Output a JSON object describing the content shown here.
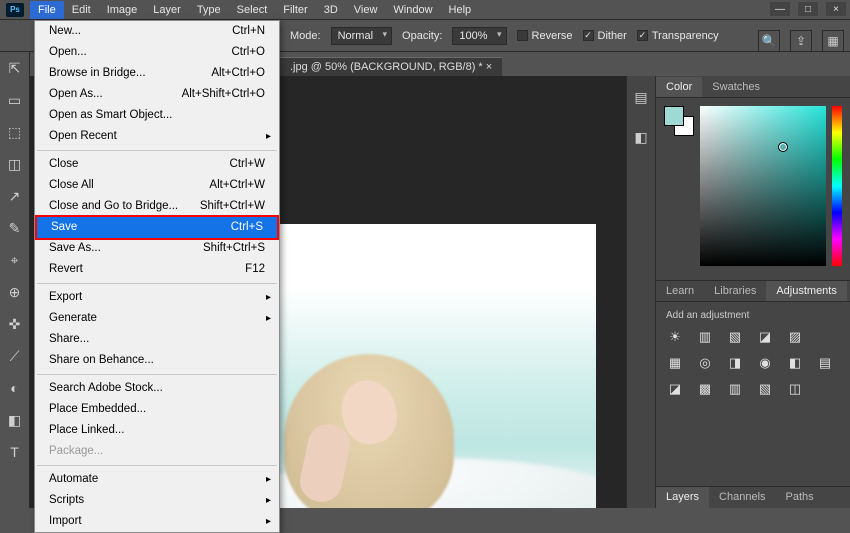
{
  "menubar": {
    "logo": "Ps",
    "items": [
      "File",
      "Edit",
      "Image",
      "Layer",
      "Type",
      "Select",
      "Filter",
      "3D",
      "View",
      "Window",
      "Help"
    ],
    "active_index": 0
  },
  "window_controls": {
    "min": "—",
    "max": "□",
    "close": "×"
  },
  "options_bar": {
    "mode_label": "Mode:",
    "mode_value": "Normal",
    "opacity_label": "Opacity:",
    "opacity_value": "100%",
    "reverse_label": "Reverse",
    "reverse_checked": false,
    "dither_label": "Dither",
    "dither_checked": true,
    "transparency_label": "Transparency",
    "transparency_checked": true
  },
  "document_tab": ".jpg @ 50% (BACKGROUND, RGB/8) *",
  "file_menu": [
    {
      "label": "New...",
      "accel": "Ctrl+N"
    },
    {
      "label": "Open...",
      "accel": "Ctrl+O"
    },
    {
      "label": "Browse in Bridge...",
      "accel": "Alt+Ctrl+O"
    },
    {
      "label": "Open As...",
      "accel": "Alt+Shift+Ctrl+O"
    },
    {
      "label": "Open as Smart Object...",
      "accel": ""
    },
    {
      "label": "Open Recent",
      "accel": "",
      "submenu": true
    },
    {
      "sep": true
    },
    {
      "label": "Close",
      "accel": "Ctrl+W"
    },
    {
      "label": "Close All",
      "accel": "Alt+Ctrl+W"
    },
    {
      "label": "Close and Go to Bridge...",
      "accel": "Shift+Ctrl+W"
    },
    {
      "label": "Save",
      "accel": "Ctrl+S",
      "highlighted": true
    },
    {
      "label": "Save As...",
      "accel": "Shift+Ctrl+S"
    },
    {
      "label": "Revert",
      "accel": "F12"
    },
    {
      "sep": true
    },
    {
      "label": "Export",
      "accel": "",
      "submenu": true
    },
    {
      "label": "Generate",
      "accel": "",
      "submenu": true
    },
    {
      "label": "Share...",
      "accel": ""
    },
    {
      "label": "Share on Behance...",
      "accel": ""
    },
    {
      "sep": true
    },
    {
      "label": "Search Adobe Stock...",
      "accel": ""
    },
    {
      "label": "Place Embedded...",
      "accel": ""
    },
    {
      "label": "Place Linked...",
      "accel": ""
    },
    {
      "label": "Package...",
      "accel": "",
      "disabled": true
    },
    {
      "sep": true
    },
    {
      "label": "Automate",
      "accel": "",
      "submenu": true
    },
    {
      "label": "Scripts",
      "accel": "",
      "submenu": true
    },
    {
      "label": "Import",
      "accel": "",
      "submenu": true
    }
  ],
  "panels": {
    "color_tab": "Color",
    "swatches_tab": "Swatches",
    "learn_tab": "Learn",
    "libraries_tab": "Libraries",
    "adjustments_tab": "Adjustments",
    "add_adjustment": "Add an adjustment",
    "layers_tab": "Layers",
    "channels_tab": "Channels",
    "paths_tab": "Paths"
  },
  "tools": [
    "⇱",
    "▭",
    "⬚",
    "◫",
    "↗",
    "✎",
    "⌖",
    "⊕",
    "✜",
    "⟋",
    "◐",
    "◧",
    "T"
  ],
  "adjust_icons_row1": [
    "☀",
    "▥",
    "▧",
    "◪",
    "▨"
  ],
  "adjust_icons_row2": [
    "▦",
    "◎",
    "◨",
    "◉",
    "◧",
    "▤"
  ],
  "adjust_icons_row3": [
    "◪",
    "▩",
    "▥",
    "▧",
    "◫"
  ]
}
